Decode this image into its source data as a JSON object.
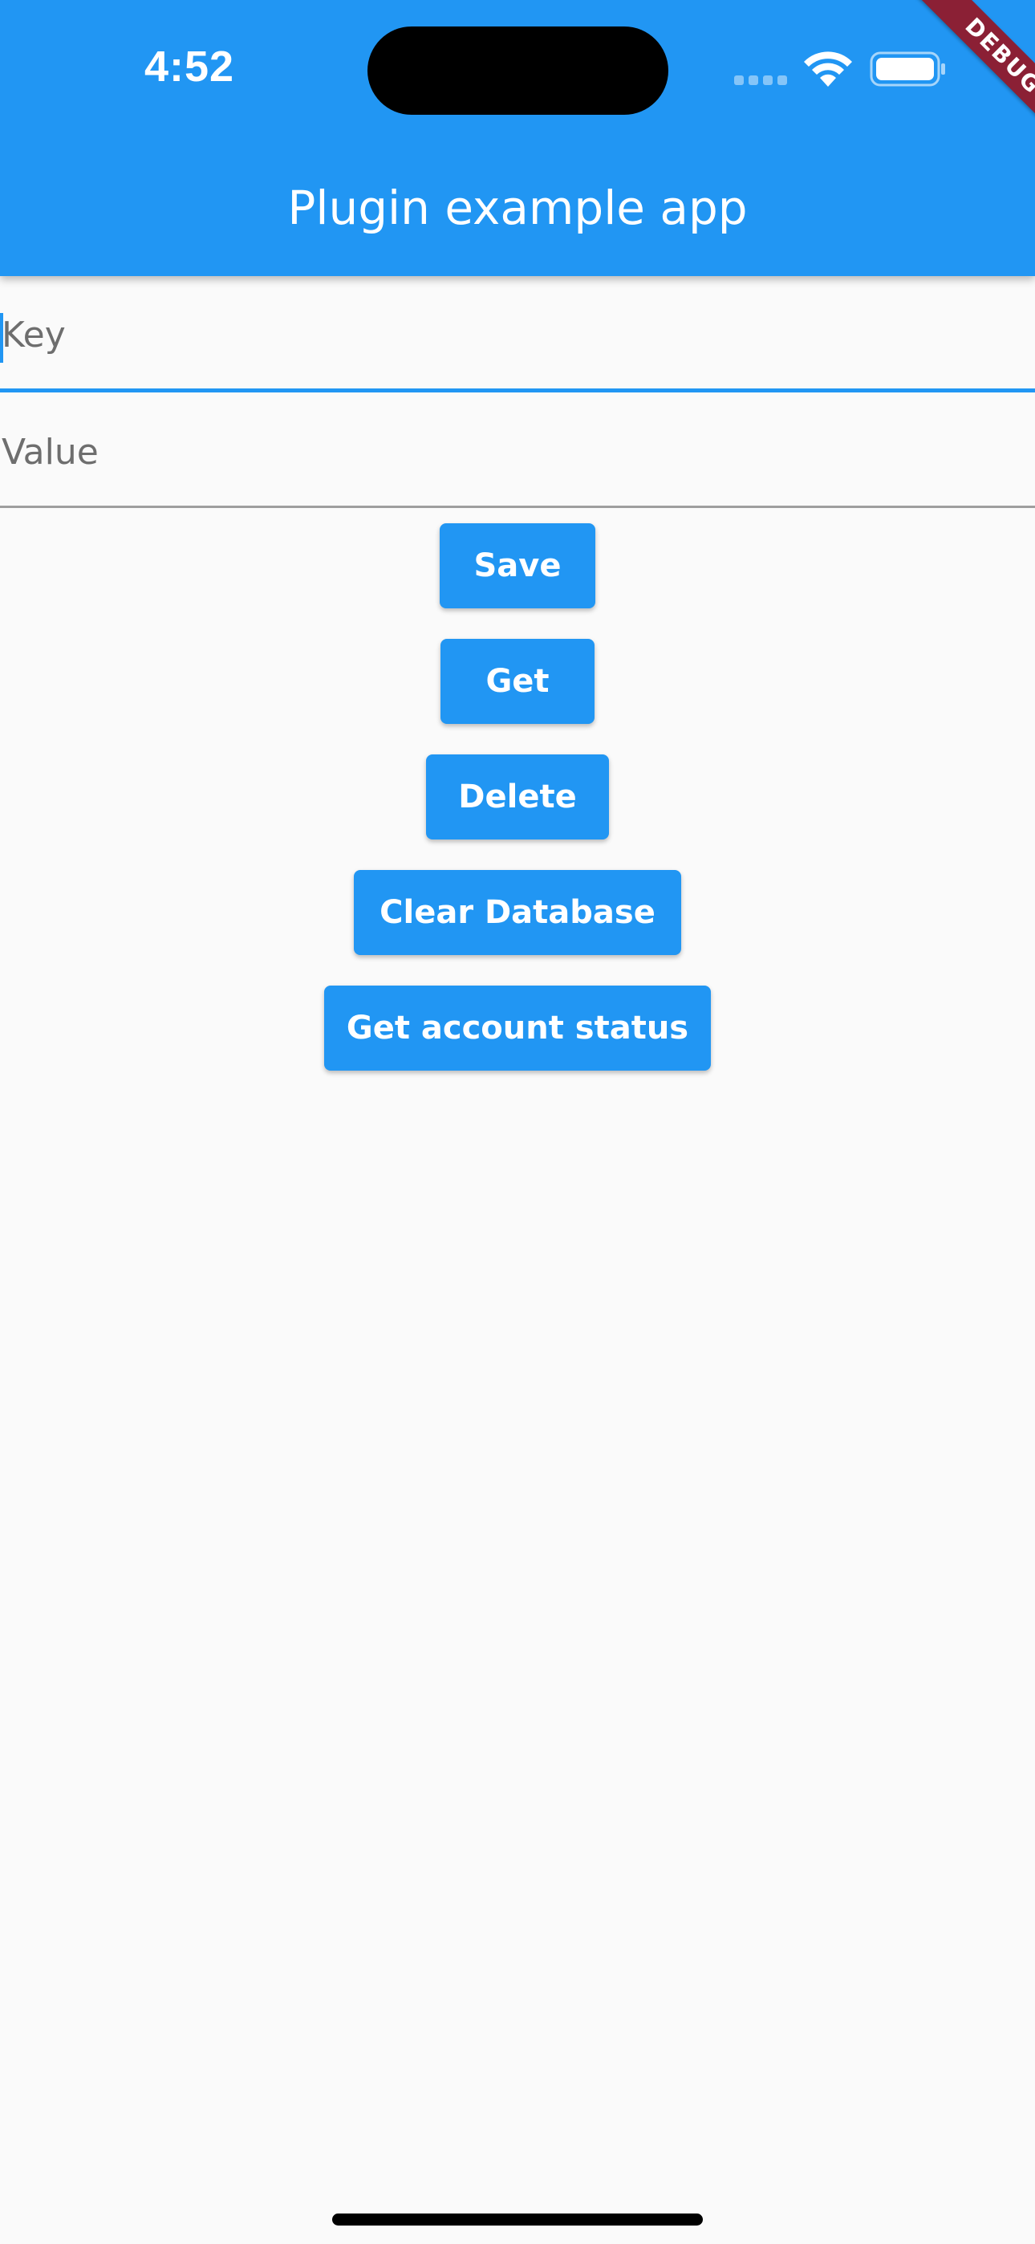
{
  "status_bar": {
    "time": "4:52",
    "icons": [
      "signal-icon",
      "wifi-icon",
      "battery-icon"
    ]
  },
  "debug_banner": "DEBUG",
  "app_bar": {
    "title": "Plugin example app"
  },
  "form": {
    "key_placeholder": "Key",
    "value_placeholder": "Value"
  },
  "buttons": {
    "save": "Save",
    "get": "Get",
    "delete": "Delete",
    "clear_database": "Clear Database",
    "get_account_status": "Get account status"
  },
  "colors": {
    "primary": "#2196f3",
    "background": "#fafafa",
    "debug_banner": "#8b2035"
  }
}
